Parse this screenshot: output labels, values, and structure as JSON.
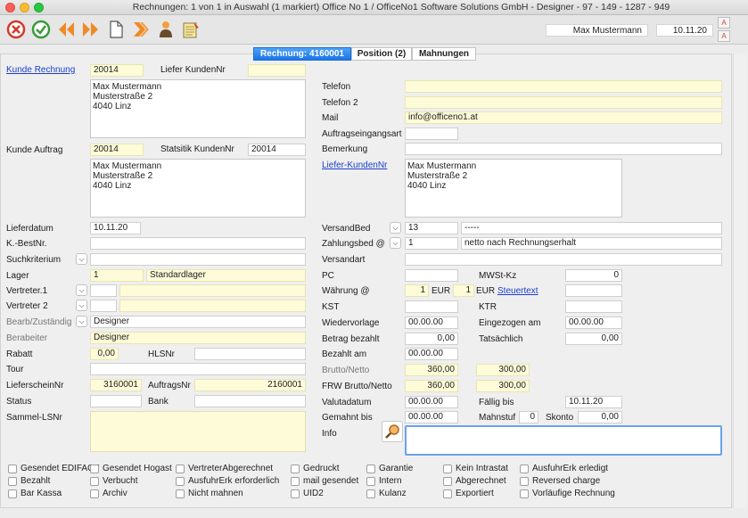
{
  "window": {
    "title": "Rechnungen: 1 von 1 in Auswahl  (1 markiert) Office No 1 /  OfficeNo1 Software Solutions GmbH - Designer - 97 - 149 - 1287 - 949",
    "user": "Max Mustermann",
    "date": "10.11.20",
    "font_btn_up": "A",
    "font_btn_down": "A"
  },
  "tabs": [
    {
      "label": "Rechnung: 4160001"
    },
    {
      "label": "Position (2)"
    },
    {
      "label": "Mahnungen"
    }
  ],
  "left": {
    "kunde_rechnung_label": "Kunde Rechnung",
    "kunde_rechnung": "20014",
    "liefer_kundennr_label": "Liefer KundenNr",
    "liefer_kundennr": "",
    "address1": "Max Mustermann\nMusterstraße 2\n4040 Linz",
    "kunde_auftrag_label": "Kunde Auftrag",
    "kunde_auftrag": "20014",
    "statistik_label": "Statsitik KundenNr",
    "statistik": "20014",
    "address2": "Max Mustermann\nMusterstraße 2\n4040 Linz",
    "lieferdatum_label": "Lieferdatum",
    "lieferdatum": "10.11.20",
    "kbestnr_label": "K.-BestNr.",
    "kbestnr": "",
    "suchkriterium_label": "Suchkriterium",
    "suchkriterium": "",
    "lager_label": "Lager",
    "lager_nr": "1",
    "lager_name": "Standardlager",
    "vertreter1_label": "Vertreter.1",
    "vertreter1_nr": "",
    "vertreter1_name": "",
    "vertreter2_label": "Vertreter 2",
    "vertreter2_nr": "",
    "vertreter2_name": "",
    "bearb_label": "Bearb/Zuständig",
    "bearb": "Designer",
    "berabeiter_label": "Berabeiter",
    "berabeiter": "Designer",
    "rabatt_label": "Rabatt",
    "rabatt": "0,00",
    "hlsnr_label": "HLSNr",
    "hlsnr": "",
    "tour_label": "Tour",
    "tour": "",
    "lieferscheinnr_label": "LieferscheinNr",
    "lieferscheinnr": "3160001",
    "auftragsnr_label": "AuftragsNr",
    "auftragsnr": "2160001",
    "status_label": "Status",
    "status": "",
    "bank_label": "Bank",
    "bank": "",
    "sammel_label": "Sammel-LSNr",
    "sammel": ""
  },
  "right": {
    "telefon_label": "Telefon",
    "telefon": "",
    "telefon2_label": "Telefon 2",
    "telefon2": "",
    "mail_label": "Mail",
    "mail": "info@officeno1.at",
    "auftragseingangsart_label": "Auftragseingangsart",
    "auftragseingangsart": "",
    "bemerkung_label": "Bemerkung",
    "bemerkung": "",
    "liefer_kundennr_label": "Liefer-KundenNr",
    "liefer_address": "Max Mustermann\nMusterstraße 2\n4040 Linz",
    "versandbed_label": "VersandBed",
    "versandbed_nr": "13",
    "versandbed_text": "-----",
    "zahlungsbed_label": "Zahlungsbed @",
    "zahlungsbed_nr": "1",
    "zahlungsbed_text": "netto nach Rechnungserhalt",
    "versandart_label": "Versandart",
    "versandart": "",
    "pc_label": "PC",
    "pc": "",
    "mwst_label": "MWSt-Kz",
    "mwst": "0",
    "waehrung_label": "Währung @",
    "waehrung_val1": "1",
    "waehrung_cur1": "EUR",
    "waehrung_val2": "1",
    "waehrung_cur2": "EUR",
    "steuertext_label": "Steuertext",
    "steuertext": "",
    "kst_label": "KST",
    "kst": "",
    "ktr_label": "KTR",
    "ktr": "",
    "wiedervorlage_label": "Wiedervorlage",
    "wiedervorlage": "00.00.00",
    "eingezogen_label": "Eingezogen am",
    "eingezogen": "00.00.00",
    "betrag_bezahlt_label": "Betrag bezahlt",
    "betrag_bezahlt": "0,00",
    "tatsaechlich_label": "Tatsächlich",
    "tatsaechlich": "0,00",
    "bezahlt_am_label": "Bezahlt am",
    "bezahlt_am": "00.00.00",
    "brutto_netto_label": "Brutto/Netto",
    "brutto": "360,00",
    "netto": "300,00",
    "frw_label": "FRW Brutto/Netto",
    "frw_brutto": "360,00",
    "frw_netto": "300,00",
    "valutadatum_label": "Valutadatum",
    "valutadatum": "00.00.00",
    "faellig_label": "Fällig bis",
    "faellig": "10.11.20",
    "gemahnt_label": "Gemahnt bis",
    "gemahnt": "00.00.00",
    "mahnstuf_label": "Mahnstuf",
    "mahnstuf": "0",
    "skonto_label": "Skonto",
    "skonto": "0,00",
    "info_label": "Info",
    "info": ""
  },
  "checkboxes": [
    [
      "Gesendet EDIFACT",
      "Gesendet Hogast",
      "VertreterAbgerechnet",
      "Gedruckt",
      "Garantie",
      "Kein Intrastat",
      "AusfuhrErk erledigt"
    ],
    [
      "Bezahlt",
      "Verbucht",
      "AusfuhrErk erforderlich",
      "mail gesendet",
      "Intern",
      "Abgerechnet",
      "Reversed charge"
    ],
    [
      "Bar Kassa",
      "Archiv",
      "Nicht mahnen",
      "UID2",
      "Kulanz",
      "Exportiert",
      "Vorläufige Rechnung"
    ]
  ]
}
